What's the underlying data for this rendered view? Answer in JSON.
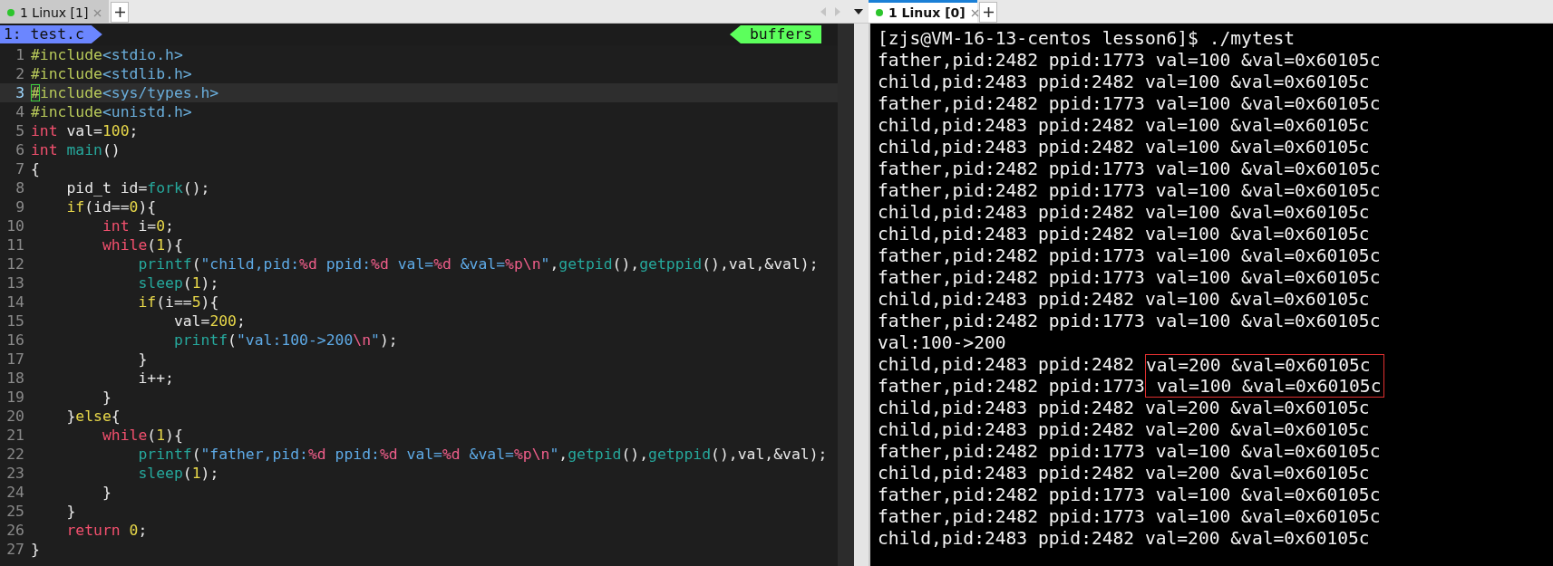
{
  "left_pane": {
    "tabs": [
      {
        "label": "1 Linux [1]",
        "selected": false
      }
    ],
    "editor": {
      "buffer_label": "1: test.c",
      "buffers_label": "buffers",
      "lines": [
        {
          "number": "1",
          "current": false,
          "segments": [
            {
              "text": "#include",
              "kind": "pre"
            },
            {
              "text": "<stdio.h>",
              "kind": "inc"
            }
          ]
        },
        {
          "number": "2",
          "current": false,
          "segments": [
            {
              "text": "#include",
              "kind": "pre"
            },
            {
              "text": "<stdlib.h>",
              "kind": "inc"
            }
          ]
        },
        {
          "number": "3",
          "current": true,
          "segments": [
            {
              "text": "#",
              "kind": "cursor"
            },
            {
              "text": "include",
              "kind": "pre"
            },
            {
              "text": "<sys/types.h>",
              "kind": "inc"
            }
          ]
        },
        {
          "number": "4",
          "current": false,
          "segments": [
            {
              "text": "#include",
              "kind": "pre"
            },
            {
              "text": "<unistd.h>",
              "kind": "inc"
            }
          ]
        },
        {
          "number": "5",
          "current": false,
          "segments": [
            {
              "text": "int",
              "kind": "type"
            },
            {
              "text": " val=",
              "kind": "plain"
            },
            {
              "text": "100",
              "kind": "num"
            },
            {
              "text": ";",
              "kind": "plain"
            }
          ]
        },
        {
          "number": "6",
          "current": false,
          "segments": [
            {
              "text": "int",
              "kind": "type"
            },
            {
              "text": " main",
              "kind": "fn"
            },
            {
              "text": "()",
              "kind": "plain"
            }
          ]
        },
        {
          "number": "7",
          "current": false,
          "segments": [
            {
              "text": "{",
              "kind": "plain"
            }
          ]
        },
        {
          "number": "8",
          "current": false,
          "segments": [
            {
              "text": "    pid_t id=",
              "kind": "plain"
            },
            {
              "text": "fork",
              "kind": "fn"
            },
            {
              "text": "();",
              "kind": "plain"
            }
          ]
        },
        {
          "number": "9",
          "current": false,
          "segments": [
            {
              "text": "    if",
              "kind": "cond"
            },
            {
              "text": "(id==",
              "kind": "plain"
            },
            {
              "text": "0",
              "kind": "num"
            },
            {
              "text": "){",
              "kind": "plain"
            }
          ]
        },
        {
          "number": "10",
          "current": false,
          "segments": [
            {
              "text": "        int",
              "kind": "type"
            },
            {
              "text": " i=",
              "kind": "plain"
            },
            {
              "text": "0",
              "kind": "num"
            },
            {
              "text": ";",
              "kind": "plain"
            }
          ]
        },
        {
          "number": "11",
          "current": false,
          "segments": [
            {
              "text": "        while",
              "kind": "type"
            },
            {
              "text": "(",
              "kind": "plain"
            },
            {
              "text": "1",
              "kind": "num"
            },
            {
              "text": "){",
              "kind": "plain"
            }
          ]
        },
        {
          "number": "12",
          "current": false,
          "segments": [
            {
              "text": "            printf",
              "kind": "fn"
            },
            {
              "text": "(",
              "kind": "plain"
            },
            {
              "text": "\"child,pid:",
              "kind": "str"
            },
            {
              "text": "%d",
              "kind": "fmt"
            },
            {
              "text": " ppid:",
              "kind": "str"
            },
            {
              "text": "%d",
              "kind": "fmt"
            },
            {
              "text": " val=",
              "kind": "str"
            },
            {
              "text": "%d",
              "kind": "fmt"
            },
            {
              "text": " &val=",
              "kind": "str"
            },
            {
              "text": "%p\\n",
              "kind": "fmt"
            },
            {
              "text": "\"",
              "kind": "str"
            },
            {
              "text": ",",
              "kind": "plain"
            },
            {
              "text": "getpid",
              "kind": "fn"
            },
            {
              "text": "(),",
              "kind": "plain"
            },
            {
              "text": "getppid",
              "kind": "fn"
            },
            {
              "text": "(),val,&val);",
              "kind": "plain"
            }
          ]
        },
        {
          "number": "13",
          "current": false,
          "segments": [
            {
              "text": "            sleep",
              "kind": "fn"
            },
            {
              "text": "(",
              "kind": "plain"
            },
            {
              "text": "1",
              "kind": "num"
            },
            {
              "text": ");",
              "kind": "plain"
            }
          ]
        },
        {
          "number": "14",
          "current": false,
          "segments": [
            {
              "text": "            if",
              "kind": "cond"
            },
            {
              "text": "(i==",
              "kind": "plain"
            },
            {
              "text": "5",
              "kind": "num"
            },
            {
              "text": "){",
              "kind": "plain"
            }
          ]
        },
        {
          "number": "15",
          "current": false,
          "segments": [
            {
              "text": "                val=",
              "kind": "plain"
            },
            {
              "text": "200",
              "kind": "num"
            },
            {
              "text": ";",
              "kind": "plain"
            }
          ]
        },
        {
          "number": "16",
          "current": false,
          "segments": [
            {
              "text": "                printf",
              "kind": "fn"
            },
            {
              "text": "(",
              "kind": "plain"
            },
            {
              "text": "\"val:100->200",
              "kind": "str"
            },
            {
              "text": "\\n",
              "kind": "fmt"
            },
            {
              "text": "\"",
              "kind": "str"
            },
            {
              "text": ");",
              "kind": "plain"
            }
          ]
        },
        {
          "number": "17",
          "current": false,
          "segments": [
            {
              "text": "            }",
              "kind": "plain"
            }
          ]
        },
        {
          "number": "18",
          "current": false,
          "segments": [
            {
              "text": "            i++;",
              "kind": "plain"
            }
          ]
        },
        {
          "number": "19",
          "current": false,
          "segments": [
            {
              "text": "        }",
              "kind": "plain"
            }
          ]
        },
        {
          "number": "20",
          "current": false,
          "segments": [
            {
              "text": "    }",
              "kind": "plain"
            },
            {
              "text": "else",
              "kind": "cond"
            },
            {
              "text": "{",
              "kind": "plain"
            }
          ]
        },
        {
          "number": "21",
          "current": false,
          "segments": [
            {
              "text": "        while",
              "kind": "type"
            },
            {
              "text": "(",
              "kind": "plain"
            },
            {
              "text": "1",
              "kind": "num"
            },
            {
              "text": "){",
              "kind": "plain"
            }
          ]
        },
        {
          "number": "22",
          "current": false,
          "segments": [
            {
              "text": "            printf",
              "kind": "fn"
            },
            {
              "text": "(",
              "kind": "plain"
            },
            {
              "text": "\"father,pid:",
              "kind": "str"
            },
            {
              "text": "%d",
              "kind": "fmt"
            },
            {
              "text": " ppid:",
              "kind": "str"
            },
            {
              "text": "%d",
              "kind": "fmt"
            },
            {
              "text": " val=",
              "kind": "str"
            },
            {
              "text": "%d",
              "kind": "fmt"
            },
            {
              "text": " &val=",
              "kind": "str"
            },
            {
              "text": "%p\\n",
              "kind": "fmt"
            },
            {
              "text": "\"",
              "kind": "str"
            },
            {
              "text": ",",
              "kind": "plain"
            },
            {
              "text": "getpid",
              "kind": "fn"
            },
            {
              "text": "(),",
              "kind": "plain"
            },
            {
              "text": "getppid",
              "kind": "fn"
            },
            {
              "text": "(),val,&val);",
              "kind": "plain"
            }
          ]
        },
        {
          "number": "23",
          "current": false,
          "segments": [
            {
              "text": "            sleep",
              "kind": "fn"
            },
            {
              "text": "(",
              "kind": "plain"
            },
            {
              "text": "1",
              "kind": "num"
            },
            {
              "text": ");",
              "kind": "plain"
            }
          ]
        },
        {
          "number": "24",
          "current": false,
          "segments": [
            {
              "text": "        }",
              "kind": "plain"
            }
          ]
        },
        {
          "number": "25",
          "current": false,
          "segments": [
            {
              "text": "    }",
              "kind": "plain"
            }
          ]
        },
        {
          "number": "26",
          "current": false,
          "segments": [
            {
              "text": "    return",
              "kind": "type"
            },
            {
              "text": " 0",
              "kind": "num"
            },
            {
              "text": ";",
              "kind": "plain"
            }
          ]
        },
        {
          "number": "27",
          "current": false,
          "segments": [
            {
              "text": "}",
              "kind": "plain"
            }
          ]
        }
      ]
    }
  },
  "right_pane": {
    "tabs": [
      {
        "label": "1 Linux [0]",
        "selected": true
      }
    ],
    "terminal": {
      "lines": [
        {
          "text": "[zjs@VM-16-13-centos lesson6]$ ./mytest",
          "boxed": false
        },
        {
          "text": "father,pid:2482 ppid:1773 val=100 &val=0x60105c",
          "boxed": false
        },
        {
          "text": "child,pid:2483 ppid:2482 val=100 &val=0x60105c",
          "boxed": false
        },
        {
          "text": "father,pid:2482 ppid:1773 val=100 &val=0x60105c",
          "boxed": false
        },
        {
          "text": "child,pid:2483 ppid:2482 val=100 &val=0x60105c",
          "boxed": false
        },
        {
          "text": "child,pid:2483 ppid:2482 val=100 &val=0x60105c",
          "boxed": false
        },
        {
          "text": "father,pid:2482 ppid:1773 val=100 &val=0x60105c",
          "boxed": false
        },
        {
          "text": "father,pid:2482 ppid:1773 val=100 &val=0x60105c",
          "boxed": false
        },
        {
          "text": "child,pid:2483 ppid:2482 val=100 &val=0x60105c",
          "boxed": false
        },
        {
          "text": "child,pid:2483 ppid:2482 val=100 &val=0x60105c",
          "boxed": false
        },
        {
          "text": "father,pid:2482 ppid:1773 val=100 &val=0x60105c",
          "boxed": false
        },
        {
          "text": "father,pid:2482 ppid:1773 val=100 &val=0x60105c",
          "boxed": false
        },
        {
          "text": "child,pid:2483 ppid:2482 val=100 &val=0x60105c",
          "boxed": false
        },
        {
          "text": "father,pid:2482 ppid:1773 val=100 &val=0x60105c",
          "boxed": false
        },
        {
          "text": "val:100->200",
          "boxed": false
        },
        {
          "text": "child,pid:2483 ppid:2482 ",
          "tail": "val=200 &val=0x60105c",
          "boxed": true
        },
        {
          "text": "father,pid:2482 ppid:1773",
          "tail": " val=100 &val=0x60105c",
          "boxed": true
        },
        {
          "text": "child,pid:2483 ppid:2482 val=200 &val=0x60105c",
          "boxed": false
        },
        {
          "text": "child,pid:2483 ppid:2482 val=200 &val=0x60105c",
          "boxed": false
        },
        {
          "text": "father,pid:2482 ppid:1773 val=100 &val=0x60105c",
          "boxed": false
        },
        {
          "text": "child,pid:2483 ppid:2482 val=200 &val=0x60105c",
          "boxed": false
        },
        {
          "text": "father,pid:2482 ppid:1773 val=100 &val=0x60105c",
          "boxed": false
        },
        {
          "text": "father,pid:2482 ppid:1773 val=100 &val=0x60105c",
          "boxed": false
        },
        {
          "text": "child,pid:2483 ppid:2482 val=200 &val=0x60105c",
          "boxed": false
        }
      ]
    }
  }
}
